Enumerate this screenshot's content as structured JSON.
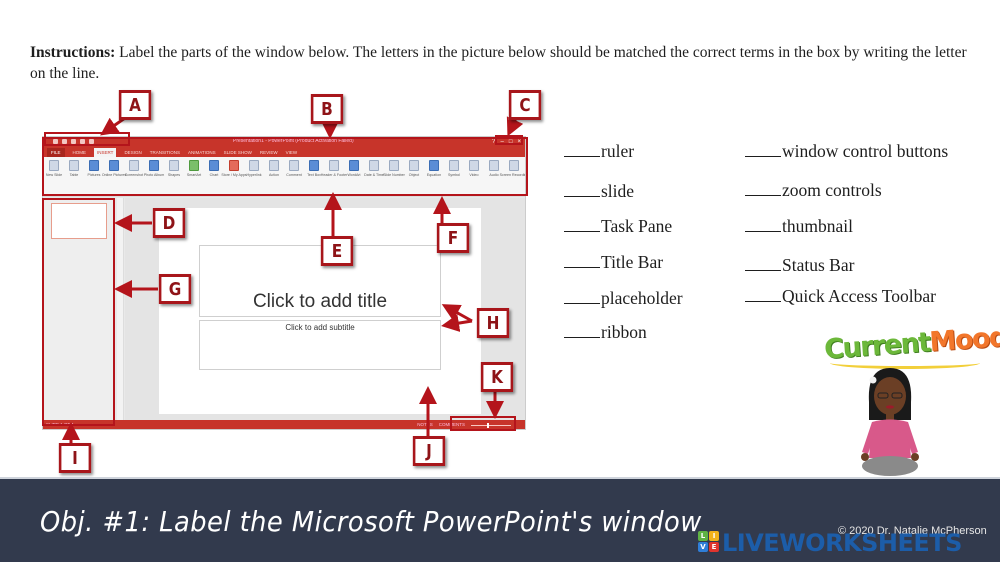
{
  "instructions": {
    "label": "Instructions:",
    "text": " Label the parts of the window below. The letters in the picture below should be matched the correct terms in the box by writing the letter on the line."
  },
  "powerpoint": {
    "title": "Presentation1 - PowerPoint (Product Activation Failed)",
    "tabs": [
      "FILE",
      "HOME",
      "INSERT",
      "DESIGN",
      "TRANSITIONS",
      "ANIMATIONS",
      "SLIDE SHOW",
      "REVIEW",
      "VIEW"
    ],
    "active_tab": "INSERT",
    "window_controls": [
      "?",
      "–",
      "□",
      "×"
    ],
    "ribbon_items": [
      {
        "label": "New Slide",
        "icon": "new-slide-icon",
        "color": ""
      },
      {
        "label": "Table",
        "icon": "table-icon",
        "color": ""
      },
      {
        "label": "Pictures",
        "icon": "pictures-icon",
        "color": "blue"
      },
      {
        "label": "Online Pictures",
        "icon": "online-pictures-icon",
        "color": "blue"
      },
      {
        "label": "Screenshot",
        "icon": "screenshot-icon",
        "color": ""
      },
      {
        "label": "Photo Album",
        "icon": "photo-album-icon",
        "color": "blue"
      },
      {
        "label": "Shapes",
        "icon": "shapes-icon",
        "color": ""
      },
      {
        "label": "SmartArt",
        "icon": "smartart-icon",
        "color": "green"
      },
      {
        "label": "Chart",
        "icon": "chart-icon",
        "color": "blue"
      },
      {
        "label": "Store / My Apps",
        "icon": "store-icon",
        "color": "red"
      },
      {
        "label": "Hyperlink",
        "icon": "hyperlink-icon",
        "color": ""
      },
      {
        "label": "Action",
        "icon": "action-icon",
        "color": ""
      },
      {
        "label": "Comment",
        "icon": "comment-icon",
        "color": ""
      },
      {
        "label": "Text Box",
        "icon": "text-box-icon",
        "color": "blue"
      },
      {
        "label": "Header & Footer",
        "icon": "header-footer-icon",
        "color": ""
      },
      {
        "label": "WordArt",
        "icon": "wordart-icon",
        "color": "blue"
      },
      {
        "label": "Date & Time",
        "icon": "date-time-icon",
        "color": ""
      },
      {
        "label": "Slide Number",
        "icon": "slide-number-icon",
        "color": ""
      },
      {
        "label": "Object",
        "icon": "object-icon",
        "color": ""
      },
      {
        "label": "Equation",
        "icon": "equation-icon",
        "color": "blue"
      },
      {
        "label": "Symbol",
        "icon": "symbol-icon",
        "color": ""
      },
      {
        "label": "Video",
        "icon": "video-icon",
        "color": ""
      },
      {
        "label": "Audio",
        "icon": "audio-icon",
        "color": ""
      },
      {
        "label": "Screen Recording",
        "icon": "screen-recording-icon",
        "color": ""
      }
    ],
    "placeholder_title": "Click to add title",
    "placeholder_subtitle": "Click to add subtitle",
    "status_left": "SLIDE 1 OF 1",
    "status_notes": "NOTES",
    "status_comments": "COMMENTS",
    "zoom_percent": "63%"
  },
  "callouts": [
    "A",
    "B",
    "C",
    "D",
    "E",
    "F",
    "G",
    "H",
    "I",
    "J",
    "K"
  ],
  "terms_left": [
    "ruler",
    "slide",
    "Task Pane",
    "Title Bar",
    "placeholder",
    "ribbon"
  ],
  "terms_right": [
    "window control buttons",
    "zoom controls",
    "thumbnail",
    "Status Bar",
    "Quick Access Toolbar"
  ],
  "mood": {
    "word1": "Current",
    "word2": "Mood"
  },
  "footer": {
    "title": "Obj. #1: Label the Microsoft PowerPoint's window",
    "credit": "© 2020 Dr. Natalie McPherson",
    "brand": "LIVEWORKSHEETS",
    "logo_letters": [
      "L",
      "I",
      "V",
      "E"
    ]
  },
  "colors": {
    "accent_red": "#b4141b",
    "ppt_red": "#c7342a",
    "footer_bg": "#323a4d",
    "brand_blue": "#1b5fae"
  }
}
